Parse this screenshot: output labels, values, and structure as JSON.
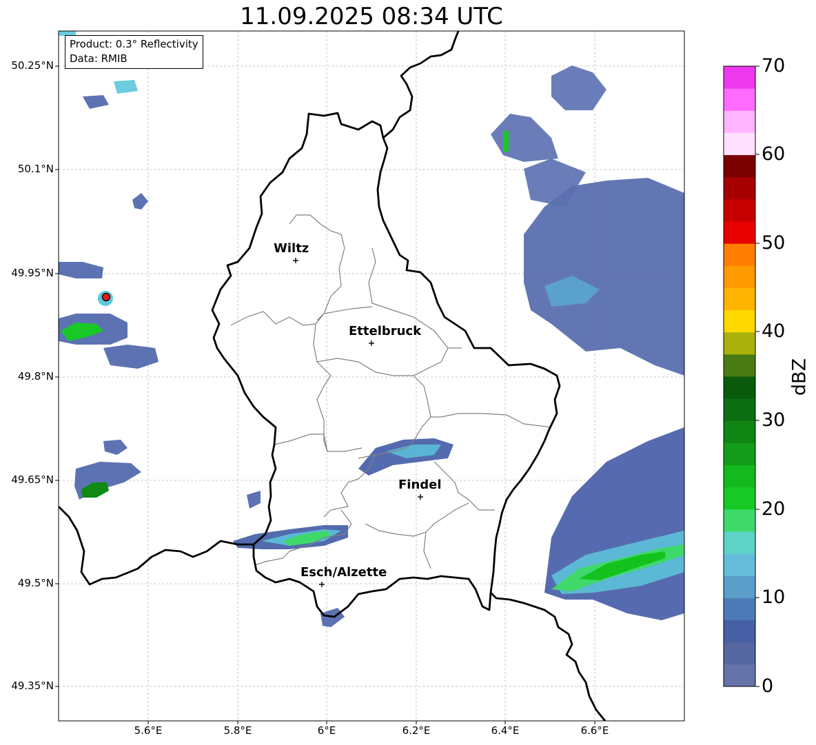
{
  "title": "11.09.2025 08:34 UTC",
  "info": {
    "product": "Product: 0.3° Reflectivity",
    "data": "Data: RMIB"
  },
  "axes": {
    "lat_ticks": [
      "50.25°N",
      "50.1°N",
      "49.95°N",
      "49.8°N",
      "49.65°N",
      "49.5°N",
      "49.35°N"
    ],
    "lon_ticks": [
      "5.6°E",
      "5.8°E",
      "6°E",
      "6.2°E",
      "6.4°E",
      "6.6°E"
    ]
  },
  "cities": [
    {
      "name": "Wiltz"
    },
    {
      "name": "Ettelbruck"
    },
    {
      "name": "Findel"
    },
    {
      "name": "Esch/Alzette"
    }
  ],
  "colorbar": {
    "label": "dBZ",
    "ticks": [
      "0",
      "10",
      "20",
      "30",
      "40",
      "50",
      "60",
      "70"
    ],
    "colors": [
      "#6574a8",
      "#5666a0",
      "#4760a5",
      "#4d7ab6",
      "#5a9ec9",
      "#65bddb",
      "#5dd3c8",
      "#3fd96b",
      "#18c925",
      "#14b81f",
      "#129c19",
      "#108514",
      "#0c6e12",
      "#0a5a0e",
      "#4a7a12",
      "#aab10b",
      "#ffd800",
      "#ffb400",
      "#ff9a00",
      "#ff7d00",
      "#e60000",
      "#c60000",
      "#a70000",
      "#7a0000",
      "#ffe1ff",
      "#ffb6ff",
      "#ff6cff",
      "#ee38ee"
    ]
  },
  "radar_site_color": "#e8191a"
}
